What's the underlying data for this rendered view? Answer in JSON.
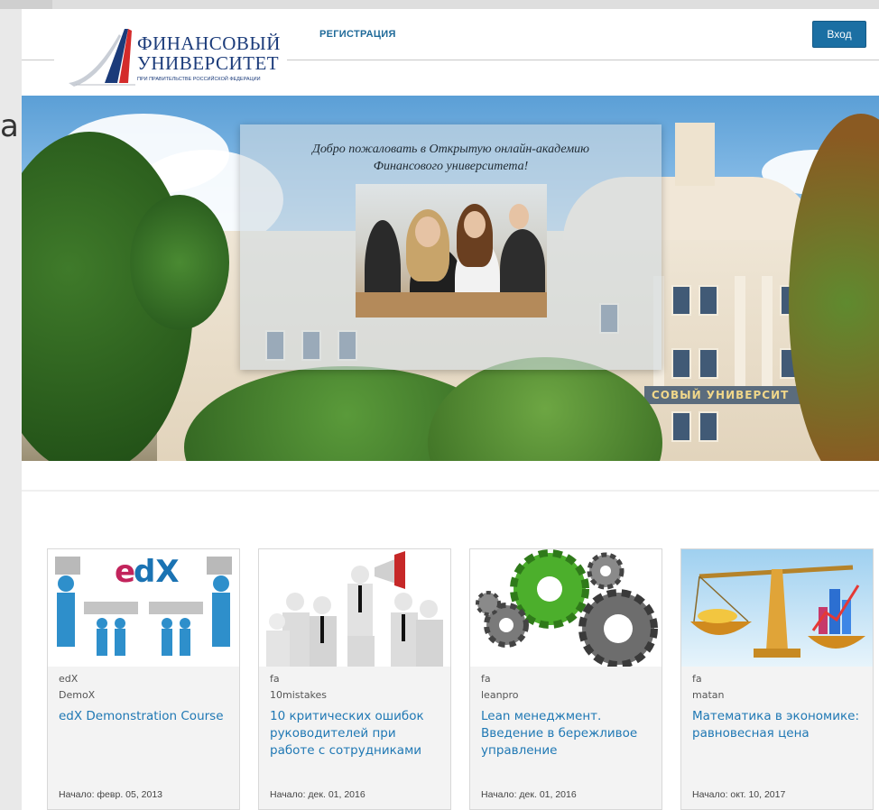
{
  "header": {
    "logo_line1": "ФИНАНСОВЫЙ",
    "logo_line2": "УНИВЕРСИТЕТ",
    "logo_sub": "ПРИ ПРАВИТЕЛЬСТВЕ РОССИЙСКОЙ ФЕДЕРАЦИИ",
    "register_link": "РЕГИСТРАЦИЯ",
    "login_button": "Вход"
  },
  "background_text": "а",
  "hero": {
    "welcome_line1": "Добро пожаловать в Открытую онлайн-академию",
    "welcome_line2": "Финансового университета!",
    "building_sign": "СОВЫЙ УНИВЕРСИТ"
  },
  "courses": [
    {
      "org": "edX",
      "code": "DemoX",
      "title": "edX Demonstration Course",
      "start": "Начало: февр. 05, 2013",
      "image": "edx-puzzle-people-icon"
    },
    {
      "org": "fa",
      "code": "10mistakes",
      "title": "10 критических ошибок руководителей при работе с сотрудниками",
      "start": "Начало: дек. 01, 2016",
      "image": "megaphone-leader-icon"
    },
    {
      "org": "fa",
      "code": "leanpro",
      "title": "Lean менеджмент. Введение в бережливое управление",
      "start": "Начало: дек. 01, 2016",
      "image": "gears-icon"
    },
    {
      "org": "fa",
      "code": "matan",
      "title": "Математика в экономике: равновесная цена",
      "start": "Начало: окт. 10, 2017",
      "image": "scales-icon"
    }
  ],
  "colors": {
    "accent": "#1b6fa3",
    "link": "#1f78b4",
    "logo_blue": "#1b3b7a",
    "logo_red": "#d42b2b"
  }
}
